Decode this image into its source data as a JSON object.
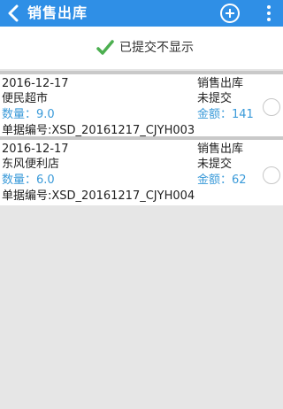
{
  "header": {
    "title": "销售出库",
    "back_icon": "chevron-left-icon",
    "add_icon": "add-circle-icon",
    "more_icon": "more-vertical-icon",
    "background_color": "#2f8fe6"
  },
  "filter": {
    "label": "已提交不显示",
    "icon": "checkmark-icon",
    "icon_color": "#4caf50"
  },
  "records": [
    {
      "date": "2016-12-17",
      "type": "销售出库",
      "store": "便民超市",
      "status": "未提交",
      "quantity": "数量：9.0",
      "amount": "金额：141",
      "doc_number": "单据编号:XSD_20161217_CJYH003"
    },
    {
      "date": "2016-12-17",
      "type": "销售出库",
      "store": "东风便利店",
      "status": "未提交",
      "quantity": "数量：6.0",
      "amount": "金额：62",
      "doc_number": "单据编号:XSD_20161217_CJYH004"
    }
  ]
}
